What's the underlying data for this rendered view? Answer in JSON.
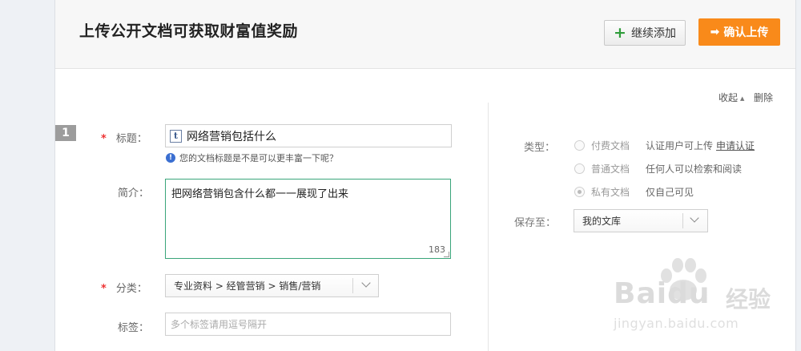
{
  "header": {
    "title": "上传公开文档可获取财富值奖励",
    "add_button": "继续添加",
    "confirm_button": "确认上传"
  },
  "item": {
    "number": "1",
    "collapse_label": "收起",
    "delete_label": "删除"
  },
  "form": {
    "title_label": "标题：",
    "title_value": "网络营销包括什么",
    "title_hint": "您的文档标题是不是可以更丰富一下呢？",
    "desc_label": "简介：",
    "desc_value": "把网络营销包含什么都一一展现了出来",
    "desc_count": "183",
    "category_label": "分类：",
    "category_value": "专业资料 > 经管营销 > 销售/营销",
    "tags_label": "标签：",
    "tags_placeholder": "多个标签请用逗号隔开"
  },
  "settings": {
    "type_label": "类型：",
    "types": [
      {
        "label": "付费文档",
        "desc": "认证用户可上传",
        "link": "申请认证",
        "selected": false
      },
      {
        "label": "普通文档",
        "desc": "任何人可以检索和阅读",
        "selected": false
      },
      {
        "label": "私有文档",
        "desc": "仅自己可见",
        "selected": true
      }
    ],
    "save_label": "保存至：",
    "save_value": "我的文库"
  },
  "watermark": {
    "brand": "Bai",
    "brand_du": "du",
    "cn": "经验",
    "url": "jingyan.baidu.com"
  },
  "colors": {
    "confirm_bg": "#f98a1a",
    "required": "#e33333",
    "desc_border": "#3aa57a"
  }
}
